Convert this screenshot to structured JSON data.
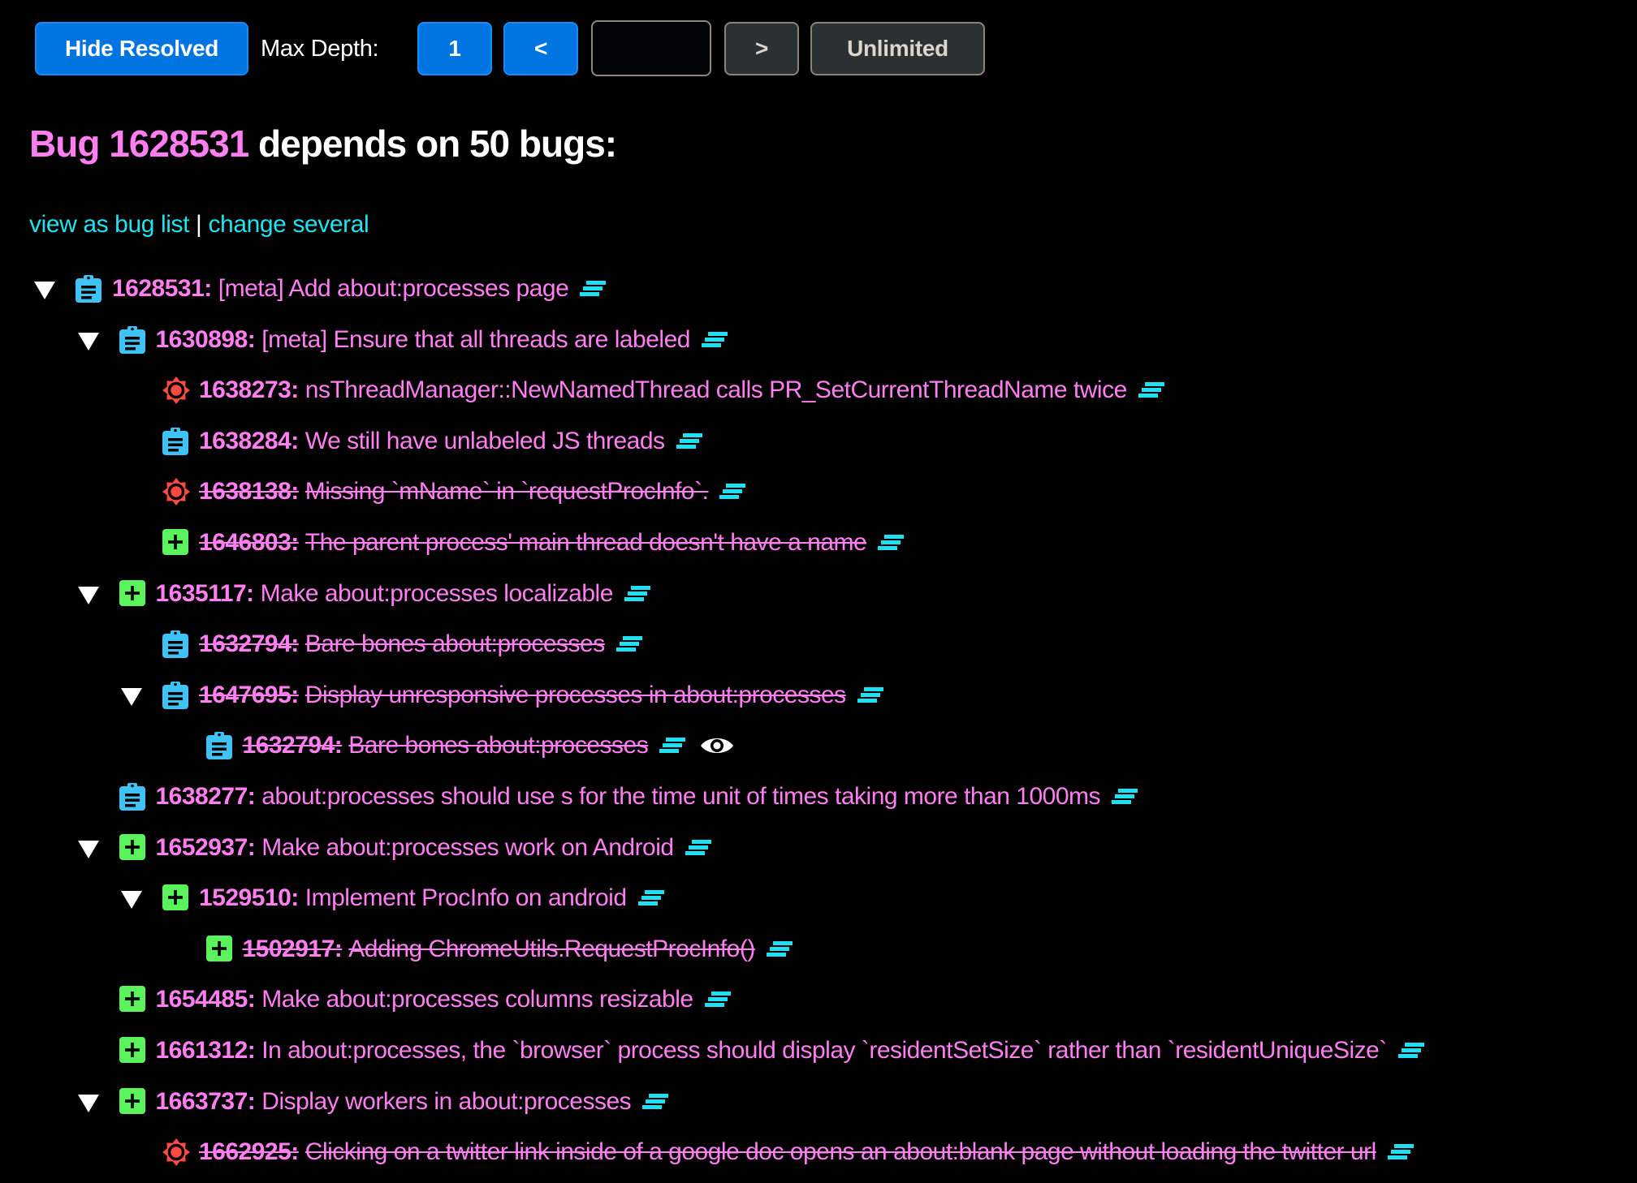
{
  "toolbar": {
    "hide_resolved_label": "Hide Resolved",
    "max_depth_label": "Max Depth:",
    "depth_one_label": "1",
    "depth_decrease_label": "<",
    "depth_input_value": "",
    "depth_increase_label": ">",
    "unlimited_label": "Unlimited"
  },
  "heading": {
    "bug_link": "Bug 1628531",
    "rest": " depends on 50 bugs:"
  },
  "links": {
    "view_as_bug_list": "view as bug list",
    "separator": "|",
    "change_several": "change several"
  },
  "colors": {
    "bug_text": "#ff7ef0",
    "link": "#21e3f0",
    "task_icon": "#3fc3f6",
    "defect_icon": "#ff4a44",
    "enhancement_icon": "#5bf35b",
    "button_blue": "#0074e0"
  },
  "tree": [
    {
      "level": 0,
      "expanded": true,
      "type": "task",
      "id": "1628531:",
      "summary": "[meta] Add about:processes page",
      "resolved": false,
      "eye": false
    },
    {
      "level": 1,
      "expanded": true,
      "type": "task",
      "id": "1630898:",
      "summary": "[meta] Ensure that all threads are labeled",
      "resolved": false,
      "eye": false
    },
    {
      "level": 2,
      "expanded": false,
      "type": "defect",
      "id": "1638273:",
      "summary": "nsThreadManager::NewNamedThread calls PR_SetCurrentThreadName twice",
      "resolved": false,
      "eye": false
    },
    {
      "level": 2,
      "expanded": false,
      "type": "task",
      "id": "1638284:",
      "summary": "We still have unlabeled JS threads",
      "resolved": false,
      "eye": false
    },
    {
      "level": 2,
      "expanded": false,
      "type": "defect",
      "id": "1638138:",
      "summary": "Missing `mName` in `requestProcInfo`.",
      "resolved": true,
      "eye": false
    },
    {
      "level": 2,
      "expanded": false,
      "type": "enhancement",
      "id": "1646803:",
      "summary": "The parent process' main thread doesn't have a name",
      "resolved": true,
      "eye": false
    },
    {
      "level": 1,
      "expanded": true,
      "type": "enhancement",
      "id": "1635117:",
      "summary": "Make about:processes localizable",
      "resolved": false,
      "eye": false
    },
    {
      "level": 2,
      "expanded": false,
      "type": "task",
      "id": "1632794:",
      "summary": "Bare bones about:processes",
      "resolved": true,
      "eye": false
    },
    {
      "level": 2,
      "expanded": true,
      "type": "task",
      "id": "1647695:",
      "summary": "Display unresponsive processes in about:processes",
      "resolved": true,
      "eye": false
    },
    {
      "level": 3,
      "expanded": false,
      "type": "task",
      "id": "1632794:",
      "summary": "Bare bones about:processes",
      "resolved": true,
      "eye": true
    },
    {
      "level": 1,
      "expanded": false,
      "type": "task",
      "id": "1638277:",
      "summary": "about:processes should use s for the time unit of times taking more than 1000ms",
      "resolved": false,
      "eye": false
    },
    {
      "level": 1,
      "expanded": true,
      "type": "enhancement",
      "id": "1652937:",
      "summary": "Make about:processes work on Android",
      "resolved": false,
      "eye": false
    },
    {
      "level": 2,
      "expanded": true,
      "type": "enhancement",
      "id": "1529510:",
      "summary": "Implement ProcInfo on android",
      "resolved": false,
      "eye": false
    },
    {
      "level": 3,
      "expanded": false,
      "type": "enhancement",
      "id": "1502917:",
      "summary": "Adding ChromeUtils.RequestProcInfo()",
      "resolved": true,
      "eye": false
    },
    {
      "level": 1,
      "expanded": false,
      "type": "enhancement",
      "id": "1654485:",
      "summary": "Make about:processes columns resizable",
      "resolved": false,
      "eye": false
    },
    {
      "level": 1,
      "expanded": false,
      "type": "enhancement",
      "id": "1661312:",
      "summary": "In about:processes, the `browser` process should display `residentSetSize` rather than `residentUniqueSize`",
      "resolved": false,
      "eye": false
    },
    {
      "level": 1,
      "expanded": true,
      "type": "enhancement",
      "id": "1663737:",
      "summary": "Display workers in about:processes",
      "resolved": false,
      "eye": false
    },
    {
      "level": 2,
      "expanded": false,
      "type": "defect",
      "id": "1662925:",
      "summary": "Clicking on a twitter link inside of a google doc opens an about:blank page without loading the twitter url",
      "resolved": true,
      "eye": false
    }
  ]
}
